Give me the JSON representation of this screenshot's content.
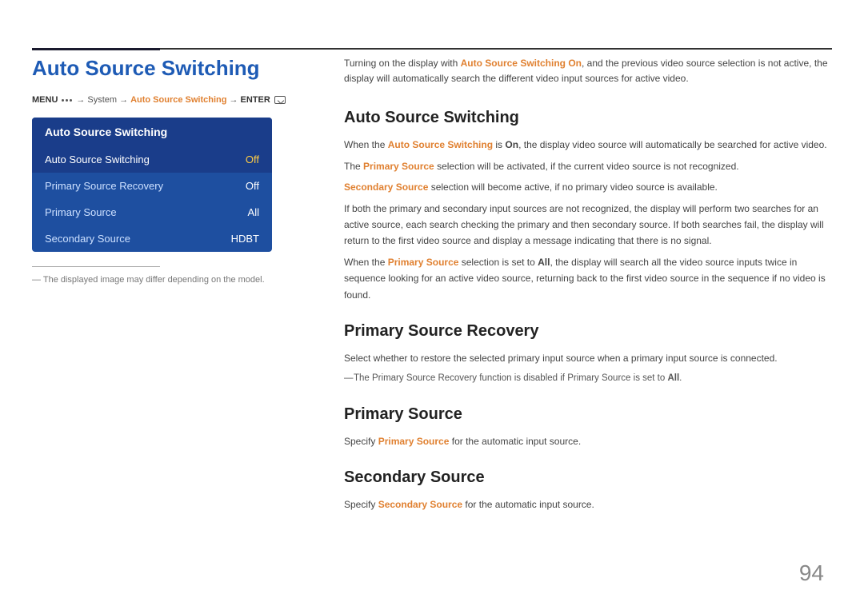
{
  "header": {
    "title": "Auto Source Switching",
    "top_line": true
  },
  "breadcrumb": {
    "menu": "MENU",
    "arrow1": "→",
    "system": "System",
    "arrow2": "→",
    "active": "Auto Source Switching",
    "arrow3": "→",
    "enter": "ENTER"
  },
  "menu_ui": {
    "title": "Auto Source Switching",
    "items": [
      {
        "label": "Auto Source Switching",
        "value": "Off",
        "active": true
      },
      {
        "label": "Primary Source Recovery",
        "value": "Off",
        "active": false
      },
      {
        "label": "Primary Source",
        "value": "All",
        "active": false
      },
      {
        "label": "Secondary Source",
        "value": "HDBT",
        "active": false
      }
    ]
  },
  "footnote": "The displayed image may differ depending on the model.",
  "intro": {
    "text_before_bold": "Turning on the display with ",
    "bold_text": "Auto Source Switching On",
    "text_after": ", and the previous video source selection is not active, the display will automatically search the different video input sources for active video."
  },
  "sections": [
    {
      "id": "auto-source-switching",
      "heading": "Auto Source Switching",
      "paragraphs": [
        {
          "type": "inline",
          "parts": [
            {
              "text": "When the ",
              "style": "normal"
            },
            {
              "text": "Auto Source Switching",
              "style": "bold-orange"
            },
            {
              "text": " is ",
              "style": "normal"
            },
            {
              "text": "On",
              "style": "bold"
            },
            {
              "text": ", the display video source will automatically be searched for active video.",
              "style": "normal"
            }
          ]
        },
        {
          "type": "inline",
          "parts": [
            {
              "text": "The ",
              "style": "normal"
            },
            {
              "text": "Primary Source",
              "style": "bold-orange"
            },
            {
              "text": " selection will be activated, if the current video source is not recognized.",
              "style": "normal"
            }
          ]
        },
        {
          "type": "inline",
          "parts": [
            {
              "text": "Secondary Source",
              "style": "bold-orange"
            },
            {
              "text": " selection will become active, if no primary video source is available.",
              "style": "normal"
            }
          ]
        },
        {
          "type": "plain",
          "text": "If both the primary and secondary input sources are not recognized, the display will perform two searches for an active source, each search checking the primary and then secondary source. If both searches fail, the display will return to the first video source and display a message indicating that there is no signal."
        },
        {
          "type": "inline",
          "parts": [
            {
              "text": "When the ",
              "style": "normal"
            },
            {
              "text": "Primary Source",
              "style": "bold-orange"
            },
            {
              "text": " selection is set to ",
              "style": "normal"
            },
            {
              "text": "All",
              "style": "bold"
            },
            {
              "text": ", the display will search all the video source inputs twice in sequence looking for an active video source, returning back to the first video source in the sequence if no video is found.",
              "style": "normal"
            }
          ]
        }
      ]
    },
    {
      "id": "primary-source-recovery",
      "heading": "Primary Source Recovery",
      "paragraphs": [
        {
          "type": "plain",
          "text": "Select whether to restore the selected primary input source when a primary input source is connected."
        }
      ],
      "note": {
        "before": "The ",
        "bold1": "Primary Source Recovery",
        "middle": " function is disabled if ",
        "bold2": "Primary Source",
        "after": " is set to ",
        "bold3": "All",
        "end": "."
      }
    },
    {
      "id": "primary-source",
      "heading": "Primary Source",
      "paragraphs": [
        {
          "type": "inline",
          "parts": [
            {
              "text": "Specify ",
              "style": "normal"
            },
            {
              "text": "Primary Source",
              "style": "bold-orange"
            },
            {
              "text": " for the automatic input source.",
              "style": "normal"
            }
          ]
        }
      ]
    },
    {
      "id": "secondary-source",
      "heading": "Secondary Source",
      "paragraphs": [
        {
          "type": "inline",
          "parts": [
            {
              "text": "Specify ",
              "style": "normal"
            },
            {
              "text": "Secondary Source",
              "style": "bold-orange"
            },
            {
              "text": " for the automatic input source.",
              "style": "normal"
            }
          ]
        }
      ]
    }
  ],
  "page_number": "94"
}
